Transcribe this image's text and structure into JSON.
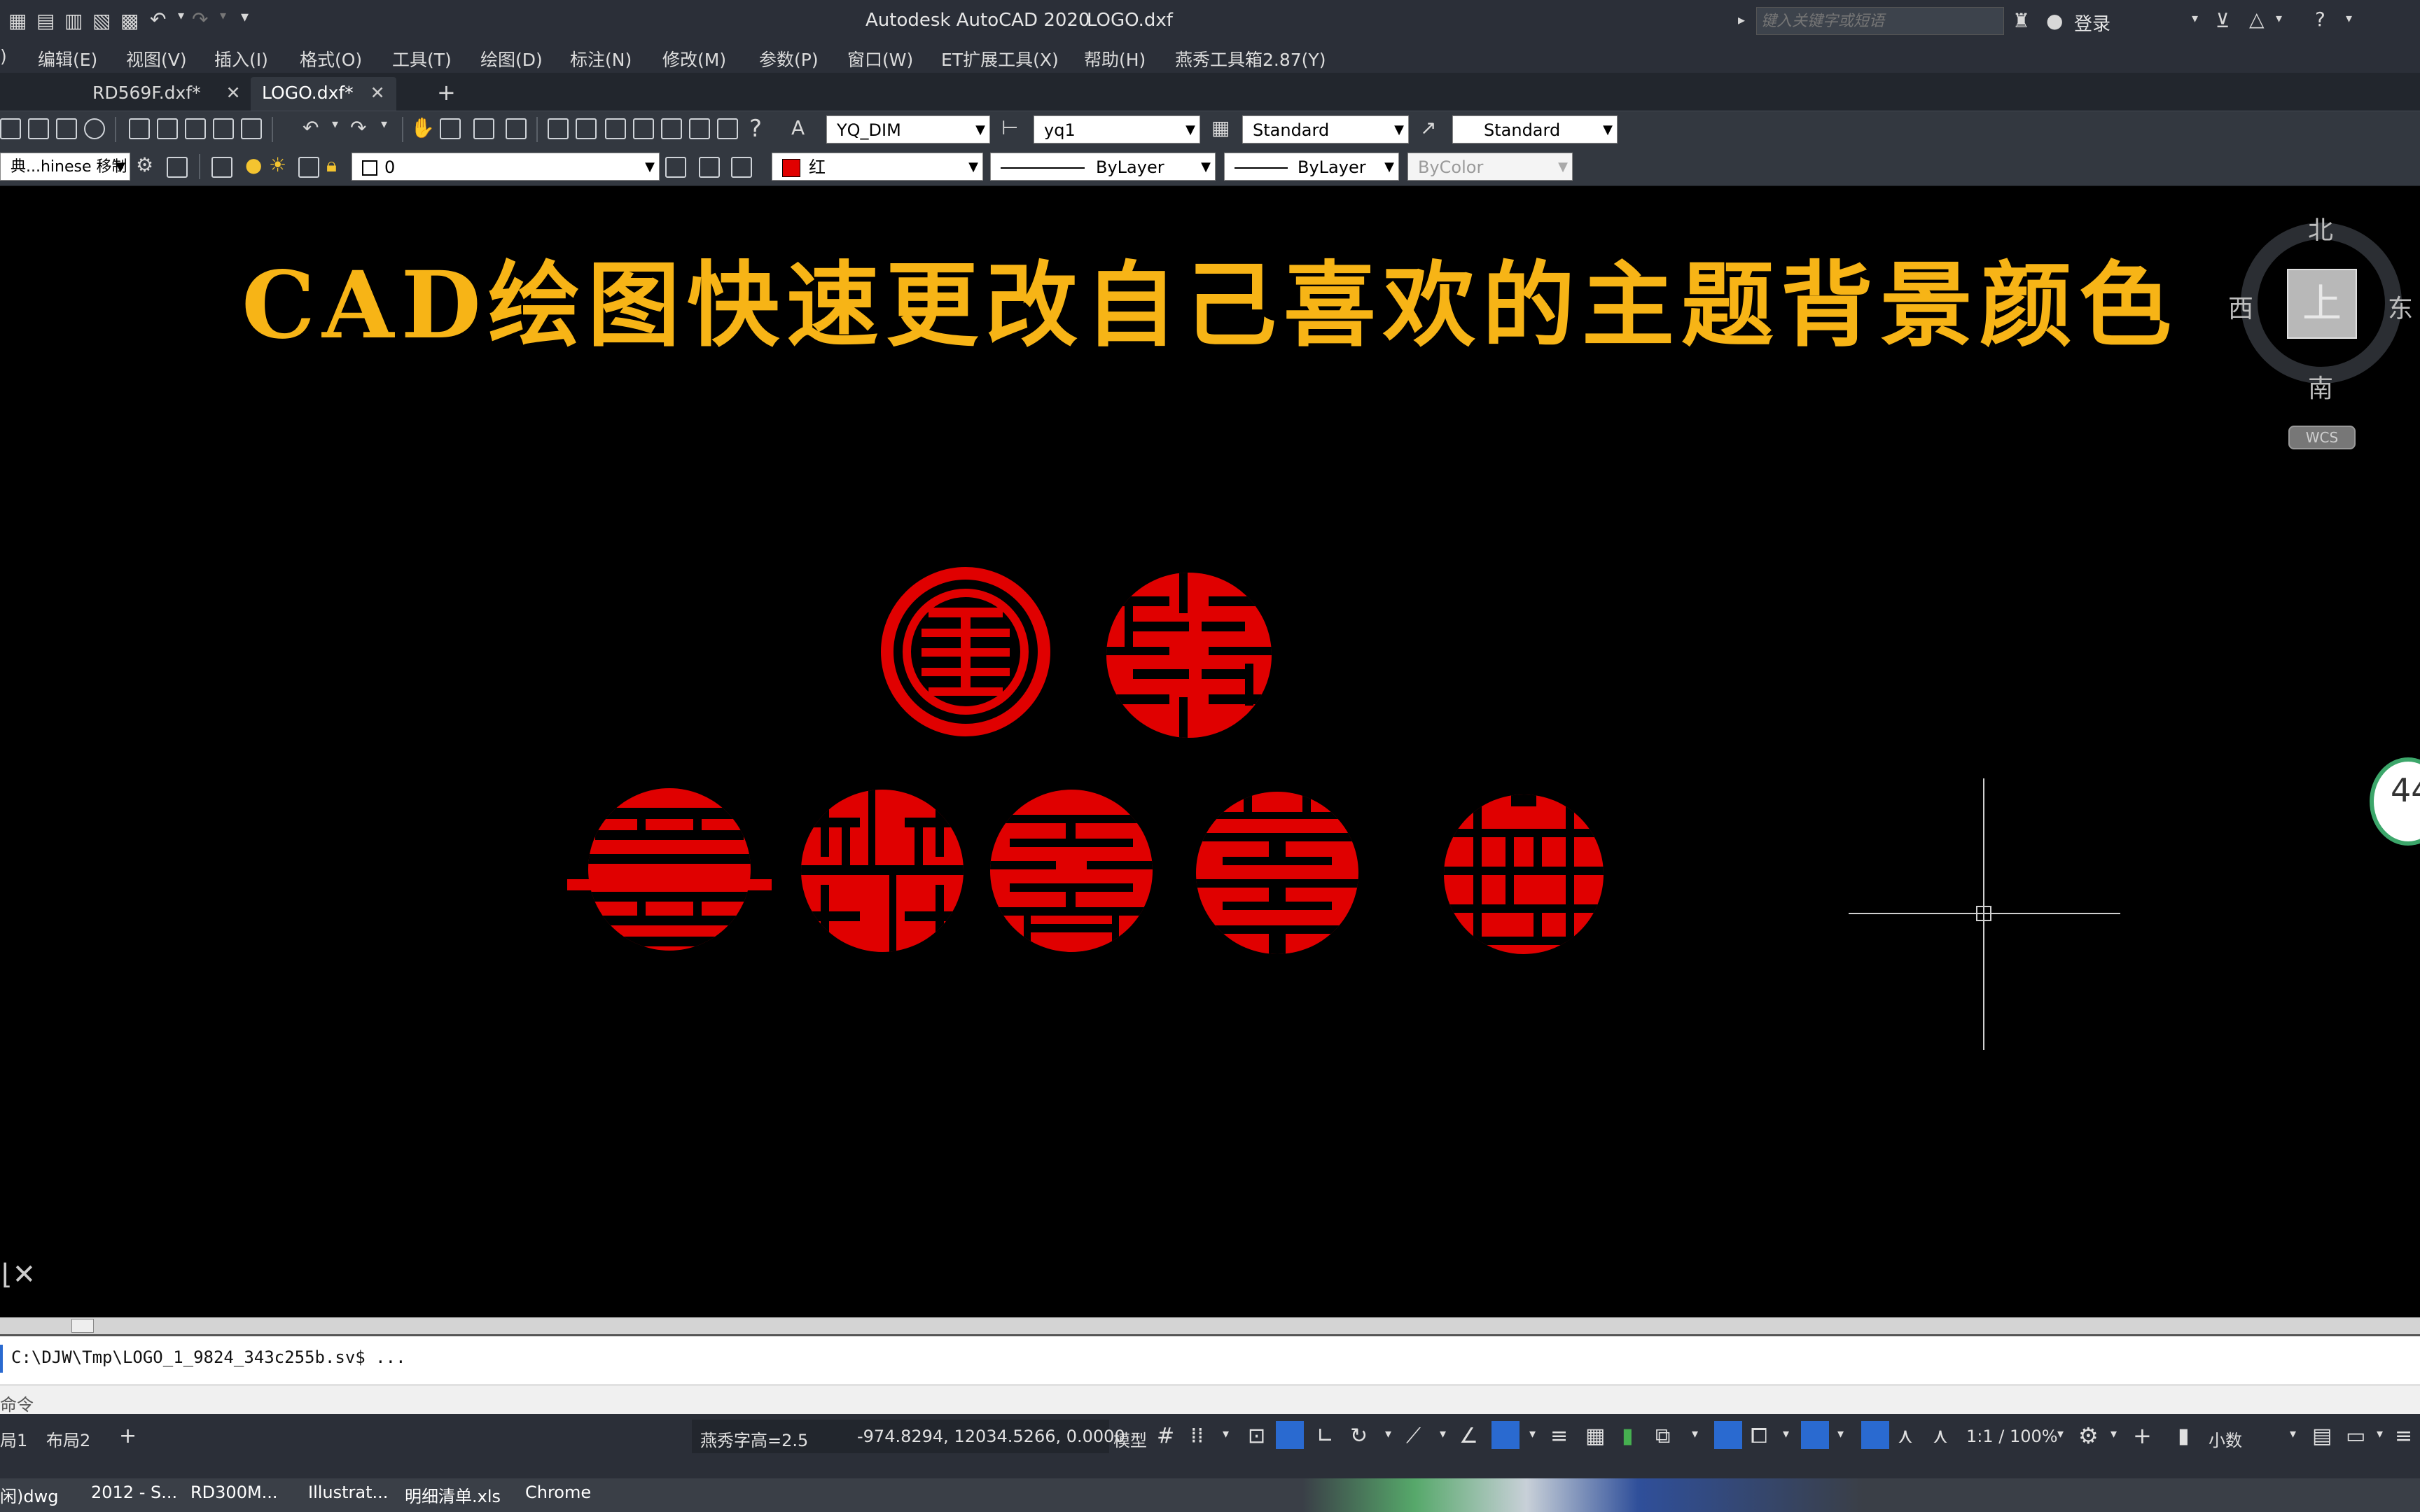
{
  "titlebar": {
    "app_title": "Autodesk AutoCAD 2020",
    "file_title": "LOGO.dxf",
    "search_placeholder": "键入关键字或短语",
    "login_label": "登录"
  },
  "menubar": {
    "items": [
      "编辑(E)",
      "视图(V)",
      "插入(I)",
      "格式(O)",
      "工具(T)",
      "绘图(D)",
      "标注(N)",
      "修改(M)",
      "参数(P)",
      "窗口(W)",
      "ET扩展工具(X)",
      "帮助(H)",
      "燕秀工具箱2.87(Y)"
    ]
  },
  "tabs": [
    {
      "label": "RD569F.dxf*",
      "active": false
    },
    {
      "label": "LOGO.dxf*",
      "active": true
    }
  ],
  "toolbar1": {
    "dim_style": "YQ_DIM",
    "mleader_style": "yq1",
    "table_style": "Standard",
    "multileader_style": "Standard"
  },
  "toolbar2": {
    "workspace": "典...hinese 移制",
    "layer": "0",
    "color": "红",
    "linetype": "ByLayer",
    "lineweight": "ByLayer",
    "plotstyle": "ByColor"
  },
  "canvas": {
    "heading": "CAD绘图快速更改自己喜欢的主题背景颜色",
    "viewcube": {
      "top": "上",
      "north": "北",
      "south": "南",
      "east": "东",
      "west": "西",
      "wcs": "WCS"
    },
    "percent_badge": "44"
  },
  "colors": {
    "background": "#000000",
    "logo": "#e00000",
    "heading": "#f7b416"
  },
  "command": {
    "history": "C:\\DJW\\Tmp\\LOGO_1_9824_343c255b.sv$ ...",
    "prompt": "命令"
  },
  "statusbar": {
    "layout_tab1": "局1",
    "layout_tab2": "布局2",
    "text_height": "燕秀字高=2.5",
    "coords": "-974.8294, 12034.5266, 0.0000",
    "model": "模型",
    "scale": "1:1 / 100%",
    "units": "小数"
  },
  "taskbar": {
    "items": [
      "闲)dwg",
      "2012 - S...",
      "RD300M...",
      "Illustrat...",
      "明细清单.xls",
      "Chrome"
    ]
  }
}
